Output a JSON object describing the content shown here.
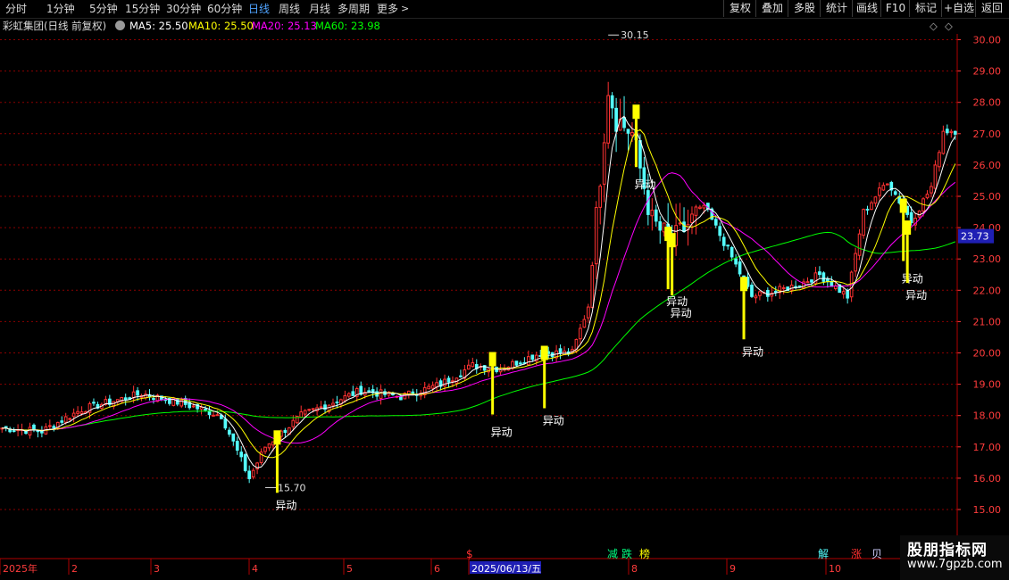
{
  "toolbar": {
    "periods": [
      "分时",
      "1分钟",
      "5分钟",
      "15分钟",
      "30分钟",
      "60分钟",
      "日线",
      "周线",
      "月线",
      "多周期",
      "更多"
    ],
    "active_period": "日线",
    "buttons": [
      "复权",
      "叠加",
      "多股",
      "统计",
      "画线",
      "F10",
      "标记",
      "+自选",
      "返回"
    ]
  },
  "info": {
    "stock_name": "彩虹集团(日线 前复权)",
    "ma5": "MA5: 25.50",
    "ma10": "MA10: 25.50",
    "ma20": "MA20: 25.13",
    "ma60": "MA60: 23.98"
  },
  "colors": {
    "up": "#ff3232",
    "down": "#54ffff",
    "ma5": "#ffffff",
    "ma10": "#ffff00",
    "ma20": "#ff00ff",
    "ma60": "#00ff00",
    "signal": "#ffff00",
    "grid": "#8b0000",
    "axis_text": "#ff3c3c",
    "price_tag_bg": "#1f1fb4"
  },
  "chart_data": {
    "type": "candlestick",
    "ylim": [
      14.6,
      30.6
    ],
    "y_ticks": [
      "30.00",
      "29.00",
      "28.00",
      "27.00",
      "26.00",
      "25.00",
      "24.00",
      "23.00",
      "22.00",
      "21.00",
      "20.00",
      "19.00",
      "18.00",
      "17.00",
      "16.00",
      "15.00"
    ],
    "x_labels": [
      "2025年",
      "2",
      "3",
      "4",
      "5",
      "6",
      "2025/06/13/五",
      "8",
      "9",
      "10"
    ],
    "current_price": "23.73",
    "high_label": "30.15",
    "low_label": "15.70",
    "signal_text": "异动",
    "bottom_markers": [
      "$",
      "减",
      "跌",
      "榜",
      "解",
      "涨",
      "贝"
    ],
    "keypoints": [
      {
        "d": 0,
        "p": 17.6
      },
      {
        "d": 10,
        "p": 17.5
      },
      {
        "d": 20,
        "p": 18.2
      },
      {
        "d": 35,
        "p": 18.7
      },
      {
        "d": 45,
        "p": 18.4
      },
      {
        "d": 55,
        "p": 18.0
      },
      {
        "d": 62,
        "p": 16.0
      },
      {
        "d": 66,
        "p": 17.0
      },
      {
        "d": 75,
        "p": 18.0
      },
      {
        "d": 90,
        "p": 18.8
      },
      {
        "d": 100,
        "p": 18.6
      },
      {
        "d": 110,
        "p": 19.0
      },
      {
        "d": 118,
        "p": 19.6
      },
      {
        "d": 125,
        "p": 19.5
      },
      {
        "d": 135,
        "p": 20.0
      },
      {
        "d": 143,
        "p": 20.0
      },
      {
        "d": 147,
        "p": 21.5
      },
      {
        "d": 152,
        "p": 28.5
      },
      {
        "d": 154,
        "p": 27.5
      },
      {
        "d": 158,
        "p": 27.0
      },
      {
        "d": 163,
        "p": 24.2
      },
      {
        "d": 168,
        "p": 23.5
      },
      {
        "d": 176,
        "p": 24.7
      },
      {
        "d": 182,
        "p": 23.3
      },
      {
        "d": 188,
        "p": 21.8
      },
      {
        "d": 195,
        "p": 22.0
      },
      {
        "d": 200,
        "p": 22.2
      },
      {
        "d": 205,
        "p": 22.5
      },
      {
        "d": 212,
        "p": 21.8
      },
      {
        "d": 216,
        "p": 24.5
      },
      {
        "d": 222,
        "p": 25.5
      },
      {
        "d": 228,
        "p": 24.2
      },
      {
        "d": 233,
        "p": 25.3
      },
      {
        "d": 236,
        "p": 27.1
      }
    ],
    "signals": [
      {
        "d": 69,
        "p": 17.3
      },
      {
        "d": 123,
        "p": 19.8
      },
      {
        "d": 136,
        "p": 20.0
      },
      {
        "d": 159,
        "p": 27.7
      },
      {
        "d": 167,
        "p": 23.8
      },
      {
        "d": 168,
        "p": 23.6
      },
      {
        "d": 186,
        "p": 22.2
      },
      {
        "d": 226,
        "p": 24.7
      },
      {
        "d": 227,
        "p": 24.0
      }
    ],
    "series": [
      {
        "name": "MA5"
      },
      {
        "name": "MA10"
      },
      {
        "name": "MA20"
      },
      {
        "name": "MA60"
      }
    ]
  },
  "watermark": {
    "title": "股朋指标网",
    "url": "www.7gpzb.com"
  }
}
